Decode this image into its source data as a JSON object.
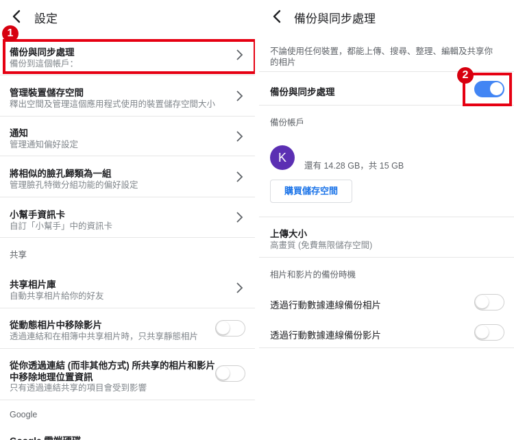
{
  "left": {
    "header_title": "設定",
    "backup": {
      "title": "備份與同步處理",
      "subtitle": "備份到這個帳戶："
    },
    "storage": {
      "title": "管理裝置儲存空間",
      "subtitle": "釋出空間及管理這個應用程式使用的裝置儲存空間大小"
    },
    "notify": {
      "title": "通知",
      "subtitle": "管理通知偏好設定"
    },
    "faces": {
      "title": "將相似的臉孔歸類為一組",
      "subtitle": "管理臉孔特徵分組功能的偏好設定"
    },
    "assistant": {
      "title": "小幫手資訊卡",
      "subtitle": "自訂「小幫手」中的資訊卡"
    },
    "share_section": "共享",
    "shared_lib": {
      "title": "共享相片庫",
      "subtitle": "自動共享相片給你的好友"
    },
    "remove_video": {
      "title": "從動態相片中移除影片",
      "subtitle": "透過連結和在相簿中共享相片時，只共享靜態相片"
    },
    "remove_geo": {
      "title_line1": "從你透過連結 (而非其他方式) 所共享的相片和影片",
      "title_line2": "中移除地理位置資訊",
      "subtitle": "只有透過連結共享的項目會受到影響"
    },
    "google_section": "Google",
    "drive": {
      "title": "Google 雲端硬碟"
    }
  },
  "right": {
    "header_title": "備份與同步處理",
    "description_line1": "不論使用任何裝置，都能上傳、搜尋、整理、編輯及共享你",
    "description_line2": "的相片",
    "backup_toggle_label": "備份與同步處理",
    "account_section": "備份帳戶",
    "avatar_letter": "K",
    "storage_text": "還有 14.28 GB，共 15 GB",
    "buy_button": "購買儲存空間",
    "upload_size": {
      "title": "上傳大小",
      "subtitle": "高畫質 (免費無限儲存空間)"
    },
    "timing_section": "相片和影片的備份時機",
    "cell_photos": "透過行動數據連線備份相片",
    "cell_videos": "透過行動數據連線備份影片"
  },
  "badges": [
    "1",
    "2"
  ],
  "states": {
    "backup_sync": true,
    "remove_video_from_motion": false,
    "remove_geo_location": false,
    "cellular_photos": false,
    "cellular_videos": false
  },
  "colors": {
    "accent": "#4285f4",
    "highlight": "#e60012",
    "avatar": "#5b2fb3",
    "link": "#1a73e8"
  },
  "icons": {
    "back": "back-arrow-icon",
    "chevron": "chevron-right-icon"
  }
}
